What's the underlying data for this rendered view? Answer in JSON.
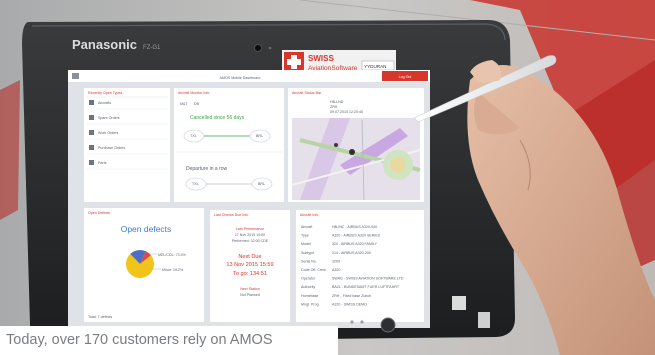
{
  "device": {
    "brand": "Panasonic",
    "model": "FZ-G1",
    "sticker_brand": "SWISS",
    "sticker_product": "AviationSoftware",
    "sticker_tail": "YYDURAN"
  },
  "screen": {
    "header_title": "AMOS Mobile Dashboard",
    "header_button": "Log Out",
    "left_panel": {
      "title": "Recently Open Types",
      "items": [
        "Aircrafts",
        "Spare Orders",
        "Work Orders",
        "Purchase Orders",
        "Parts"
      ]
    },
    "aircraft_panel": {
      "title": "Aircraft Monitor Info",
      "tab_a": "M&T",
      "tab_b": "DB",
      "label_1": "Cancelled since 56 days",
      "label_2": "Departure in a row",
      "flight_1_from": "TXL",
      "flight_1_to": "BRL",
      "flight_2_from": "TXL",
      "flight_2_to": "BRL"
    },
    "map_panel": {
      "title": "Aircraft Status Bar",
      "reg_label": "HB-LND",
      "location_label": "ZRH",
      "time_label": "09.07.2015 12:20:45"
    },
    "defects_panel": {
      "title": "Open Defects",
      "label": "Open defects",
      "callout_1": "MEL/CDL: 73.4%",
      "callout_2": "Minor: 19.2%",
      "footer": "Total: 7 defects"
    },
    "next_due_panel": {
      "title": "Last Checks Due Info",
      "line_1": "Last Performance",
      "line_2": "17 Nov 2015 10:00",
      "line_3": "Performed: 32:00 CDE",
      "line_4": "Next Due",
      "line_5": "13 Nov 2015 15:59",
      "line_6": "To go: 134:51",
      "line_7": "Next Station",
      "line_8": "Not Planned"
    },
    "info_panel": {
      "title": "Aircraft Info",
      "rows": [
        [
          "Aircraft",
          "HB-INC - AIRBUS A320-940"
        ],
        [
          "Type",
          "A320 - AIRBUS A320 SERIES"
        ],
        [
          "Model",
          "320 - AIRBUS A320 FAMILY"
        ],
        [
          "Subtype",
          "214 - AIRBUS A320-200"
        ],
        [
          "Serial No.",
          "3209"
        ],
        [
          "Code Off. Crew",
          "A320"
        ],
        [
          "Operator",
          "SWAG - SWISS AVIATION SOFTWARE LTD"
        ],
        [
          "Authority",
          "BAZL - BUNDESAMT FUER LUFTFAHRT"
        ],
        [
          "Homebase",
          "ZRH - Fixed base Zurich"
        ],
        [
          "Mngt. Prog.",
          "A320 - SWISS DEMO"
        ]
      ]
    }
  },
  "caption": {
    "text": "Today, over 170 customers rely on AMOS"
  },
  "chart_data": {
    "type": "pie",
    "values": [
      73.4,
      19.2,
      7.4
    ],
    "labels": [
      "MEL/CDL: 73.4%",
      "Minor: 19.2%",
      ""
    ],
    "colors": [
      "#f0c419",
      "#4a6fc4",
      "#e04848"
    ]
  }
}
